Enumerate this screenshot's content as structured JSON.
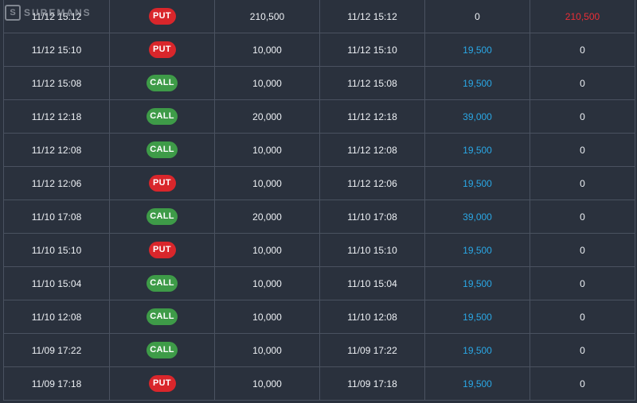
{
  "brand": {
    "watermark_text": "SUREMANS"
  },
  "colors": {
    "put": "#d9262b",
    "call": "#3e9b48",
    "payout": "#2aa8e6",
    "loss": "#ea2e36"
  },
  "rows": [
    {
      "open_time": "11/12 15:12",
      "direction": "PUT",
      "amount": "210,500",
      "close_time": "11/12 15:12",
      "payout": "0",
      "loss": "210,500"
    },
    {
      "open_time": "11/12 15:10",
      "direction": "PUT",
      "amount": "10,000",
      "close_time": "11/12 15:10",
      "payout": "19,500",
      "loss": "0"
    },
    {
      "open_time": "11/12 15:08",
      "direction": "CALL",
      "amount": "10,000",
      "close_time": "11/12 15:08",
      "payout": "19,500",
      "loss": "0"
    },
    {
      "open_time": "11/12 12:18",
      "direction": "CALL",
      "amount": "20,000",
      "close_time": "11/12 12:18",
      "payout": "39,000",
      "loss": "0"
    },
    {
      "open_time": "11/12 12:08",
      "direction": "CALL",
      "amount": "10,000",
      "close_time": "11/12 12:08",
      "payout": "19,500",
      "loss": "0"
    },
    {
      "open_time": "11/12 12:06",
      "direction": "PUT",
      "amount": "10,000",
      "close_time": "11/12 12:06",
      "payout": "19,500",
      "loss": "0"
    },
    {
      "open_time": "11/10 17:08",
      "direction": "CALL",
      "amount": "20,000",
      "close_time": "11/10 17:08",
      "payout": "39,000",
      "loss": "0"
    },
    {
      "open_time": "11/10 15:10",
      "direction": "PUT",
      "amount": "10,000",
      "close_time": "11/10 15:10",
      "payout": "19,500",
      "loss": "0"
    },
    {
      "open_time": "11/10 15:04",
      "direction": "CALL",
      "amount": "10,000",
      "close_time": "11/10 15:04",
      "payout": "19,500",
      "loss": "0"
    },
    {
      "open_time": "11/10 12:08",
      "direction": "CALL",
      "amount": "10,000",
      "close_time": "11/10 12:08",
      "payout": "19,500",
      "loss": "0"
    },
    {
      "open_time": "11/09 17:22",
      "direction": "CALL",
      "amount": "10,000",
      "close_time": "11/09 17:22",
      "payout": "19,500",
      "loss": "0"
    },
    {
      "open_time": "11/09 17:18",
      "direction": "PUT",
      "amount": "10,000",
      "close_time": "11/09 17:18",
      "payout": "19,500",
      "loss": "0"
    }
  ]
}
